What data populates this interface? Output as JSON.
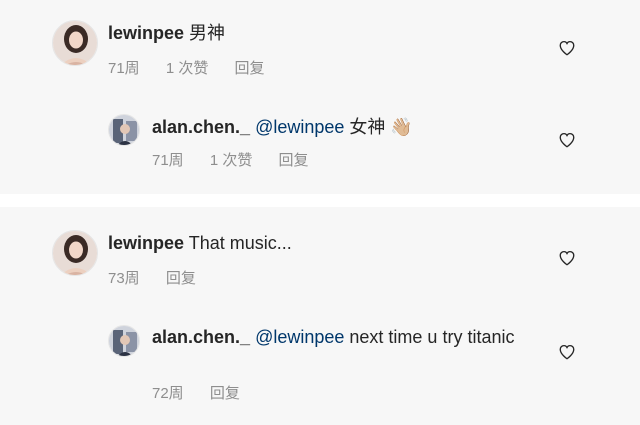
{
  "comments": [
    {
      "username": "lewinpee",
      "text": "男神",
      "time": "71周",
      "likes": "1 次赞",
      "reply": "回复",
      "replies": [
        {
          "username": "alan.chen._",
          "mention": "@lewinpee",
          "text": "女神",
          "emoji": "👋🏼",
          "time": "71周",
          "likes": "1 次赞",
          "reply": "回复"
        }
      ]
    },
    {
      "username": "lewinpee",
      "text": "That music...",
      "time": "73周",
      "reply": "回复",
      "replies": [
        {
          "username": "alan.chen._",
          "mention": "@lewinpee",
          "text": "next time u try titanic",
          "time": "72周",
          "reply": "回复"
        }
      ]
    }
  ],
  "colors": {
    "background": "#f7f7f7",
    "mention": "#00376b",
    "meta": "#8e8e8e"
  },
  "icons": {
    "like": "heart-icon"
  }
}
